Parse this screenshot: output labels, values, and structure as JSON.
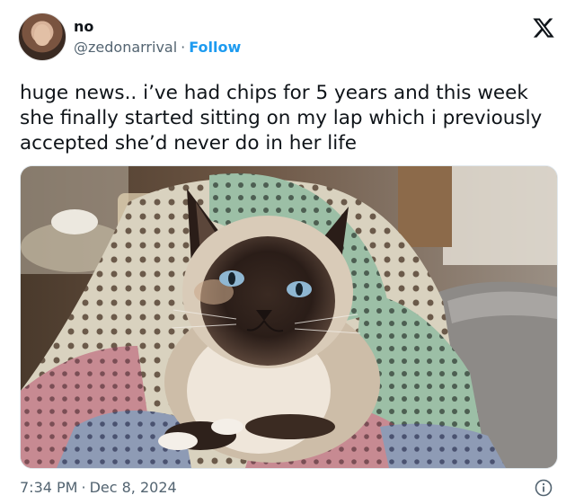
{
  "user": {
    "name": "no",
    "handle": "@zedonarrival",
    "separator": "·",
    "follow_label": "Follow"
  },
  "tweet": {
    "text": "huge news.. i’ve had chips for 5 years and this week she finally started sitting on my lap which i previously accepted she’d never do in her life"
  },
  "meta": {
    "time": "7:34 PM",
    "separator": "·",
    "date": "Dec 8, 2024"
  },
  "icons": {
    "brand": "x-logo-icon",
    "info": "info-icon"
  },
  "colors": {
    "follow": "#1d9bf0",
    "secondary_text": "#536471",
    "primary_text": "#0f1419"
  }
}
